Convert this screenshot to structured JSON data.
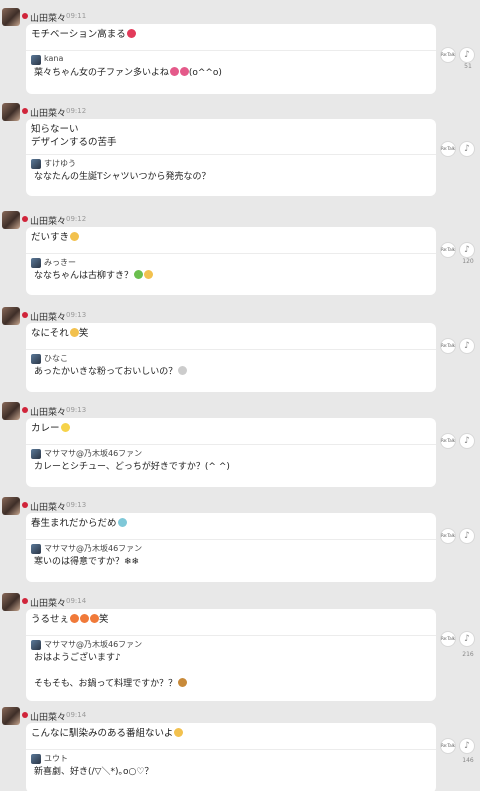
{
  "author": "山田菜々",
  "talk_label": "Re:Talk",
  "share_glyph": "♪",
  "posts": [
    {
      "time": "09:11",
      "message": "モチベーション高まる",
      "emoji": [
        "#e23b5a"
      ],
      "reply_user": "kana",
      "reply_message": "菜々ちゃん女の子ファン多いよね",
      "reply_emoji": [
        "#e45a8a",
        "#e45a8a"
      ],
      "reply_tail": "(o^^o)",
      "count": "51"
    },
    {
      "time": "09:12",
      "message": "知らなーい\nデザインするの苦手",
      "emoji": [],
      "reply_user": "すけゆう",
      "reply_message": "ななたんの生誕Tシャツいつから発売なの？",
      "reply_emoji": [],
      "reply_tail": "",
      "count": ""
    },
    {
      "time": "09:12",
      "message": "だいすき",
      "emoji": [
        "#f2c14e"
      ],
      "reply_user": "みっきー",
      "reply_message": "ななちゃんは古柳すき？",
      "reply_emoji": [
        "#6bbf4e",
        "#f2c14e"
      ],
      "reply_tail": "",
      "count": "120"
    },
    {
      "time": "09:13",
      "message": "なにそれ",
      "emoji": [
        "#f2c14e"
      ],
      "message_tail": "笑",
      "reply_user": "ひなこ",
      "reply_message": "あったかいきな粉っておいしいの？",
      "reply_emoji": [
        "#cccccc"
      ],
      "reply_tail": "",
      "count": ""
    },
    {
      "time": "09:13",
      "message": "カレー",
      "emoji": [
        "#f6d34a"
      ],
      "reply_user": "マサマサ@乃木坂46ファン",
      "reply_message": "カレーとシチュー、どっちが好きですか？(^ ^)",
      "reply_emoji": [],
      "reply_tail": "",
      "count": ""
    },
    {
      "time": "09:13",
      "message": "春生まれだからだめ",
      "emoji": [
        "#7fc8d8"
      ],
      "reply_user": "マサマサ@乃木坂46ファン",
      "reply_message": "寒いのは得意ですか？❄❄",
      "reply_emoji": [],
      "reply_tail": "",
      "count": ""
    },
    {
      "time": "09:14",
      "message": "うるせぇ",
      "emoji": [
        "#f07a3a",
        "#f07a3a",
        "#f07a3a"
      ],
      "message_tail": "笑",
      "reply_user": "マサマサ@乃木坂46ファン",
      "reply_message": "おはようございます♪\n\nそもそも、お鍋って料理ですか？？",
      "reply_emoji": [
        "#c88a3a"
      ],
      "reply_tail": "",
      "count": "216"
    },
    {
      "time": "09:14",
      "message": "こんなに馴染みのある番組ないよ",
      "emoji": [
        "#f2c14e"
      ],
      "reply_user": "ユウト",
      "reply_message": "新喜劇、好き(/▽＼*)｡o○♡？",
      "reply_emoji": [],
      "reply_tail": "",
      "count": "146"
    }
  ]
}
